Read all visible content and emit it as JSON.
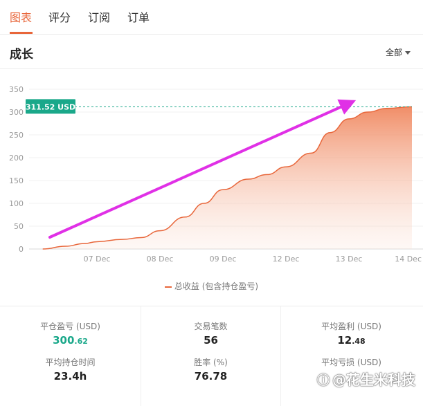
{
  "tabs": [
    {
      "label": "图表",
      "active": true
    },
    {
      "label": "评分",
      "active": false
    },
    {
      "label": "订阅",
      "active": false
    },
    {
      "label": "订单",
      "active": false
    }
  ],
  "section": {
    "title": "成长",
    "filter_label": "全部"
  },
  "chart_data": {
    "type": "area",
    "categories": [
      "07 Dec",
      "08 Dec",
      "09 Dec",
      "12 Dec",
      "13 Dec",
      "14 Dec"
    ],
    "y_ticks": [
      0,
      50,
      100,
      150,
      200,
      250,
      300,
      350
    ],
    "ylim": [
      0,
      350
    ],
    "series": [
      {
        "name": "总收益 (包含持仓盈亏)",
        "color": "#e8663a",
        "points": [
          [
            -0.86,
            0
          ],
          [
            -0.5,
            6
          ],
          [
            -0.2,
            12
          ],
          [
            0,
            16
          ],
          [
            0.4,
            21
          ],
          [
            0.7,
            25
          ],
          [
            1.0,
            40
          ],
          [
            1.4,
            70
          ],
          [
            1.7,
            100
          ],
          [
            2.0,
            130
          ],
          [
            2.4,
            153
          ],
          [
            2.7,
            163
          ],
          [
            3.0,
            180
          ],
          [
            3.4,
            210
          ],
          [
            3.7,
            255
          ],
          [
            4.0,
            285
          ],
          [
            4.3,
            300
          ],
          [
            4.6,
            308
          ],
          [
            5.0,
            311.52
          ]
        ]
      }
    ],
    "marker": {
      "value": 311.52,
      "label": "311.52 USD",
      "color": "#1aa88a"
    },
    "annotation": {
      "type": "arrow",
      "color": "#e030e6"
    },
    "legend": "bottom-center",
    "grid": true
  },
  "stats": [
    {
      "label": "平仓盈亏 (USD)",
      "value_int": "300",
      "value_dec": ".62",
      "green": true
    },
    {
      "label": "交易笔数",
      "value_int": "56",
      "value_dec": "",
      "green": false
    },
    {
      "label": "平均盈利 (USD)",
      "value_int": "12",
      "value_dec": ".48",
      "green": false
    },
    {
      "label": "平均持仓时间",
      "value_int": "23.4h",
      "value_dec": "",
      "green": false
    },
    {
      "label": "胜率 (%)",
      "value_int": "76.78",
      "value_dec": "",
      "green": false
    },
    {
      "label": "平均亏损 (USD)",
      "value_int": "",
      "value_dec": "",
      "green": false
    }
  ],
  "watermark": "@花生米科技"
}
